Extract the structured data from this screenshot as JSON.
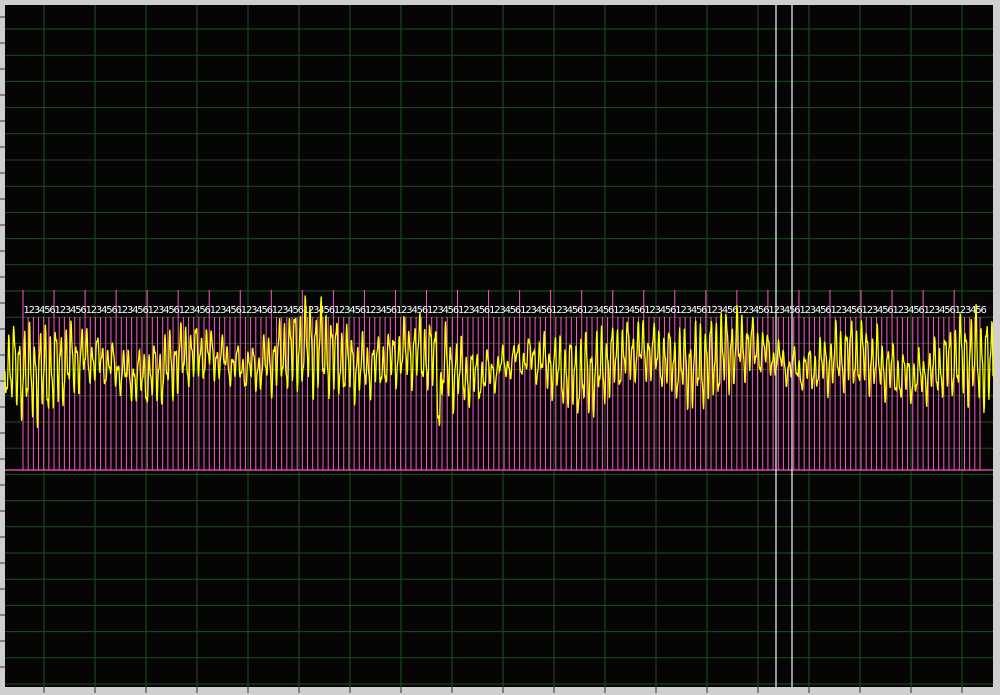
{
  "scope": {
    "background_color": "#050505",
    "frame_color": "#cfcfcf",
    "grid_color": "#1d4f1d",
    "signal_color": "#ffff00",
    "marker_color": "#ff55c8",
    "label_color": "#ffffff",
    "cursor_color": "#e6e6e6"
  },
  "markers": {
    "cycle_labels": [
      "1",
      "2",
      "3",
      "4",
      "5",
      "6"
    ],
    "label_sequence": "123456123456123456123456123456123456123456123456123456123456123456123456123456123456123456123456123456123456123456123456123456123456123456123456123456123456123456123456123456123456123456"
  },
  "cursors": {
    "count": 2,
    "style": "vertical-line"
  }
}
